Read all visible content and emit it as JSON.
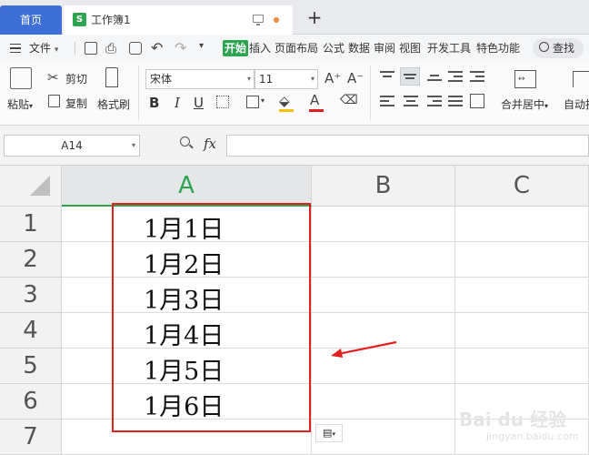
{
  "tabs": {
    "home": "首页",
    "doc_icon": "S",
    "doc_name": "工作簿1",
    "add": "+"
  },
  "menu": {
    "file": "文件",
    "items": [
      "开始",
      "插入",
      "页面布局",
      "公式",
      "数据",
      "审阅",
      "视图",
      "开发工具",
      "特色功能"
    ],
    "active_item": "开始",
    "search": "查找"
  },
  "ribbon": {
    "paste": "粘贴",
    "cut": "剪切",
    "copy": "复制",
    "format_painter": "格式刷",
    "font_name": "宋体",
    "font_size": "11",
    "bold": "B",
    "italic": "I",
    "underline": "U",
    "grow": "A⁺",
    "shrink": "A⁻",
    "font_color": "A",
    "merge_center": "合并居中",
    "auto_wrap": "自动换"
  },
  "formula_bar": {
    "name_box": "A14",
    "fx": "fx",
    "value": ""
  },
  "grid": {
    "columns": [
      "A",
      "B",
      "C"
    ],
    "active_column": "A",
    "rows": [
      "1",
      "2",
      "3",
      "4",
      "5",
      "6",
      "7"
    ],
    "cells_A": [
      "1月1日",
      "1月2日",
      "1月3日",
      "1月4日",
      "1月5日",
      "1月6日",
      ""
    ]
  },
  "watermark": {
    "logo": "Bai du 经验",
    "url": "jingyan.baidu.com"
  },
  "colors": {
    "accent": "#2da44e",
    "home_tab": "#3d6fd6",
    "annotation": "#e02020"
  }
}
